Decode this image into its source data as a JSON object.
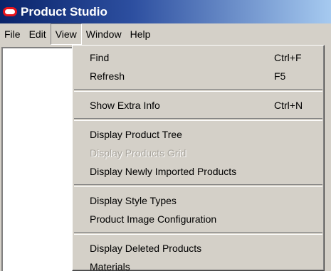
{
  "window": {
    "title": "Product Studio"
  },
  "colors": {
    "titlebar_start": "#0a246a",
    "titlebar_end": "#a6caf0",
    "app_icon": "#e8141b",
    "menu_background": "#d4d0c8",
    "disabled_text": "#a8a49c"
  },
  "menubar": {
    "items": [
      {
        "label": "File"
      },
      {
        "label": "Edit"
      },
      {
        "label": "View"
      },
      {
        "label": "Window"
      },
      {
        "label": "Help"
      }
    ]
  },
  "view_menu": {
    "groups": [
      [
        {
          "label": "Find",
          "shortcut": "Ctrl+F"
        },
        {
          "label": "Refresh",
          "shortcut": "F5"
        }
      ],
      [
        {
          "label": "Show Extra Info",
          "shortcut": "Ctrl+N"
        }
      ],
      [
        {
          "label": "Display Product Tree",
          "shortcut": ""
        },
        {
          "label": "Display Products Grid",
          "shortcut": "",
          "disabled": true
        },
        {
          "label": "Display Newly Imported Products",
          "shortcut": ""
        }
      ],
      [
        {
          "label": "Display Style Types",
          "shortcut": ""
        },
        {
          "label": "Product Image Configuration",
          "shortcut": ""
        }
      ],
      [
        {
          "label": "Display Deleted Products",
          "shortcut": ""
        },
        {
          "label": "Materials",
          "shortcut": ""
        }
      ]
    ]
  }
}
